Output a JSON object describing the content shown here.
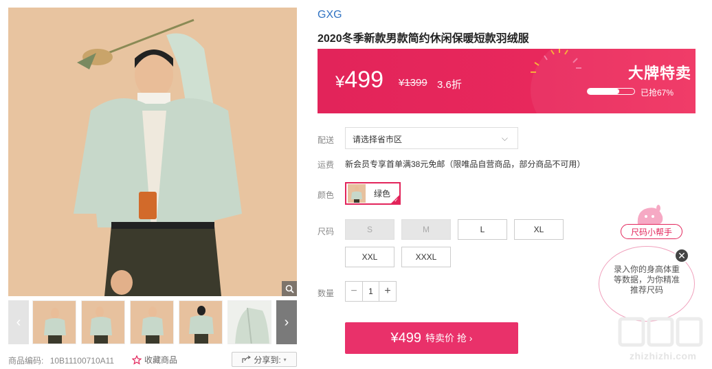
{
  "product": {
    "brand": "GXG",
    "title": "2020冬季新款男款简约休闲保暖短款羽绒服",
    "sku_label": "商品编码:",
    "sku": "10B11100710A11",
    "favorite_label": "收藏商品",
    "share_label": "分享到:"
  },
  "price": {
    "currency": "¥",
    "current": "499",
    "original": "¥1399",
    "discount": "3.6折",
    "sale_tag": "大牌特卖",
    "progress_text": "已抢67%",
    "progress_fraction": 0.67
  },
  "shipping": {
    "delivery_label": "配送",
    "address_placeholder": "请选择省市区",
    "fee_label": "运费",
    "fee_text": "新会员专享首单满38元免邮（限唯品自营商品，部分商品不可用）"
  },
  "color": {
    "label": "颜色",
    "options": [
      {
        "name": "绿色",
        "selected": true
      }
    ]
  },
  "size": {
    "label": "尺码",
    "options": [
      {
        "name": "S",
        "available": false
      },
      {
        "name": "M",
        "available": false
      },
      {
        "name": "L",
        "available": true
      },
      {
        "name": "XL",
        "available": true
      },
      {
        "name": "XXL",
        "available": true
      },
      {
        "name": "XXXL",
        "available": true
      }
    ]
  },
  "quantity": {
    "label": "数量",
    "minus": "−",
    "value": "1",
    "plus": "+"
  },
  "buy_button": {
    "price": "¥499",
    "label": "特卖价 抢 ›"
  },
  "size_helper": {
    "tag": "尺码小帮手",
    "bubble_text": "录入你的身高体重等数据，为你精准推荐尺码",
    "close": "✕"
  },
  "watermark": "zhizhizhi.com",
  "colors": {
    "accent": "#e2245a",
    "buy": "#e9316a",
    "brand_link": "#2f72c2"
  },
  "icons": [
    "zoom-icon",
    "star-icon",
    "share-icon",
    "chevron-down-icon",
    "arrow-left-icon",
    "arrow-right-icon",
    "close-icon",
    "check-icon"
  ]
}
